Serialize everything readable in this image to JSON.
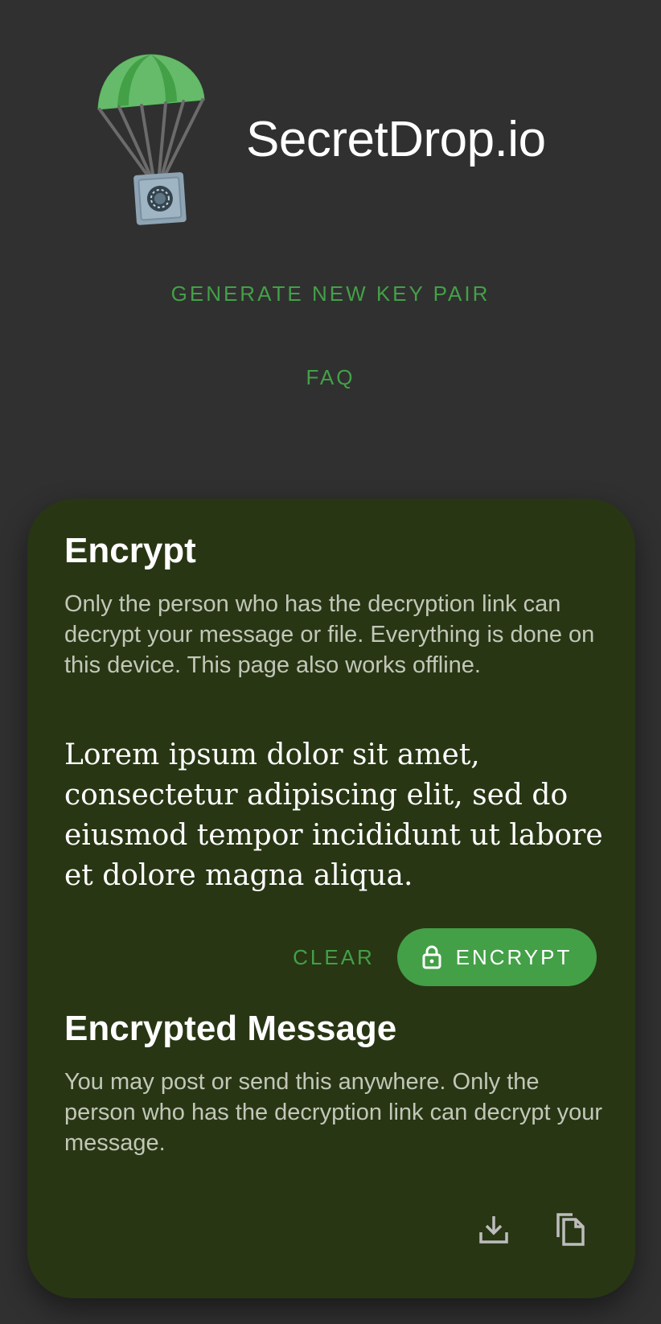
{
  "app": {
    "title": "SecretDrop.io"
  },
  "nav": {
    "generate_key_pair": "GENERATE NEW KEY PAIR",
    "faq": "FAQ"
  },
  "encrypt_card": {
    "heading": "Encrypt",
    "description": "Only the person who has the decryption link can decrypt your message or file. Everything is done on this device. This page also works offline.",
    "message_value": "Lorem ipsum dolor sit amet, consectetur adipiscing elit, sed do eiusmod tempor incididunt ut labore et dolore magna aliqua.",
    "clear_label": "CLEAR",
    "encrypt_label": "ENCRYPT",
    "encrypted_heading": "Encrypted Message",
    "encrypted_description": "You may post or send this anywhere. Only the person who has the decryption link can decrypt your message."
  },
  "icons": {
    "logo": "parachute-safe-logo",
    "encrypt": "lock-icon",
    "download": "download-icon",
    "copy": "copy-icon"
  },
  "colors": {
    "background": "#303030",
    "card": "#283614",
    "accent": "#43a047",
    "text": "#ffffff",
    "muted_text": "#c2c7b8"
  }
}
